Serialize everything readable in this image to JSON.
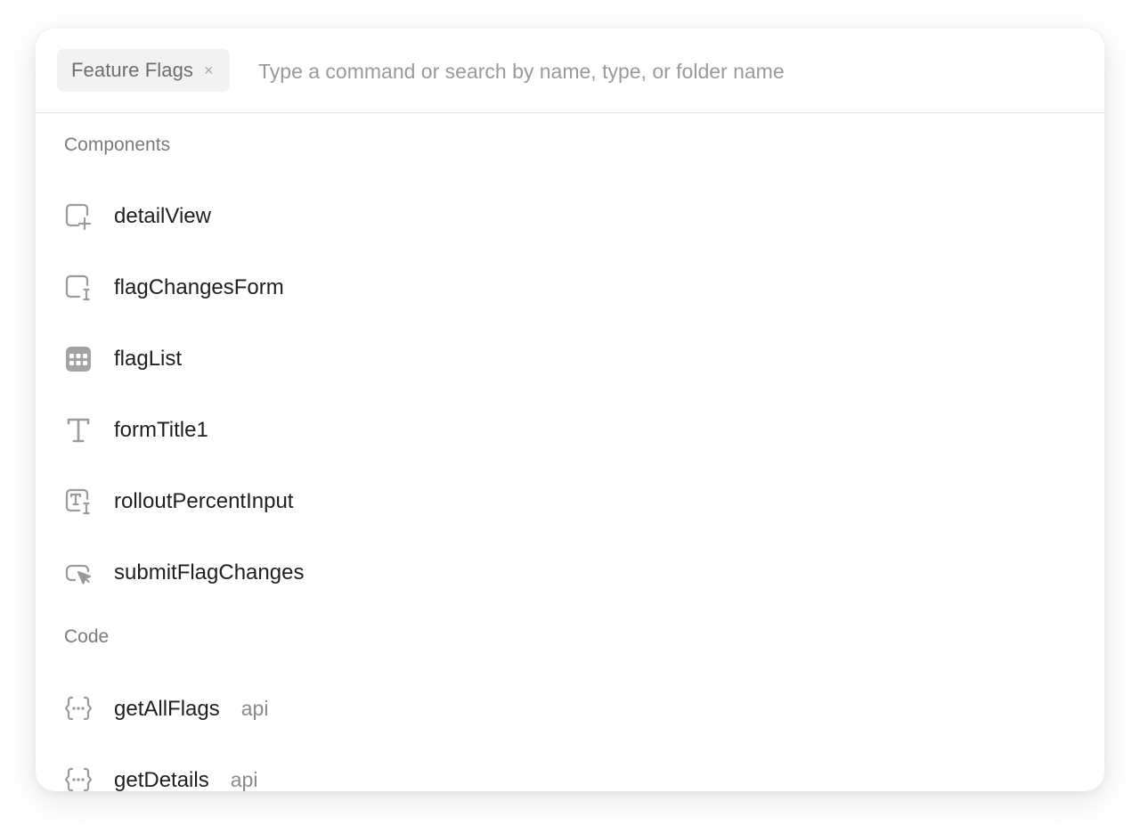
{
  "search": {
    "scope_chip": "Feature Flags",
    "scope_close": "×",
    "placeholder": "Type a command or search by name, type, or folder name"
  },
  "sections": {
    "components": {
      "title": "Components",
      "items": [
        {
          "label": "detailView",
          "icon": "container-add-icon"
        },
        {
          "label": "flagChangesForm",
          "icon": "form-icon"
        },
        {
          "label": "flagList",
          "icon": "table-icon"
        },
        {
          "label": "formTitle1",
          "icon": "text-icon"
        },
        {
          "label": "rolloutPercentInput",
          "icon": "text-input-icon"
        },
        {
          "label": "submitFlagChanges",
          "icon": "button-cursor-icon"
        }
      ]
    },
    "code": {
      "title": "Code",
      "items": [
        {
          "label": "getAllFlags",
          "meta": "api",
          "icon": "query-braces-icon"
        },
        {
          "label": "getDetails",
          "meta": "api",
          "icon": "query-braces-icon"
        }
      ]
    }
  },
  "colors": {
    "icon": "#9b9b9b",
    "text": "#1f1f1f",
    "muted": "#7a7a7a"
  }
}
